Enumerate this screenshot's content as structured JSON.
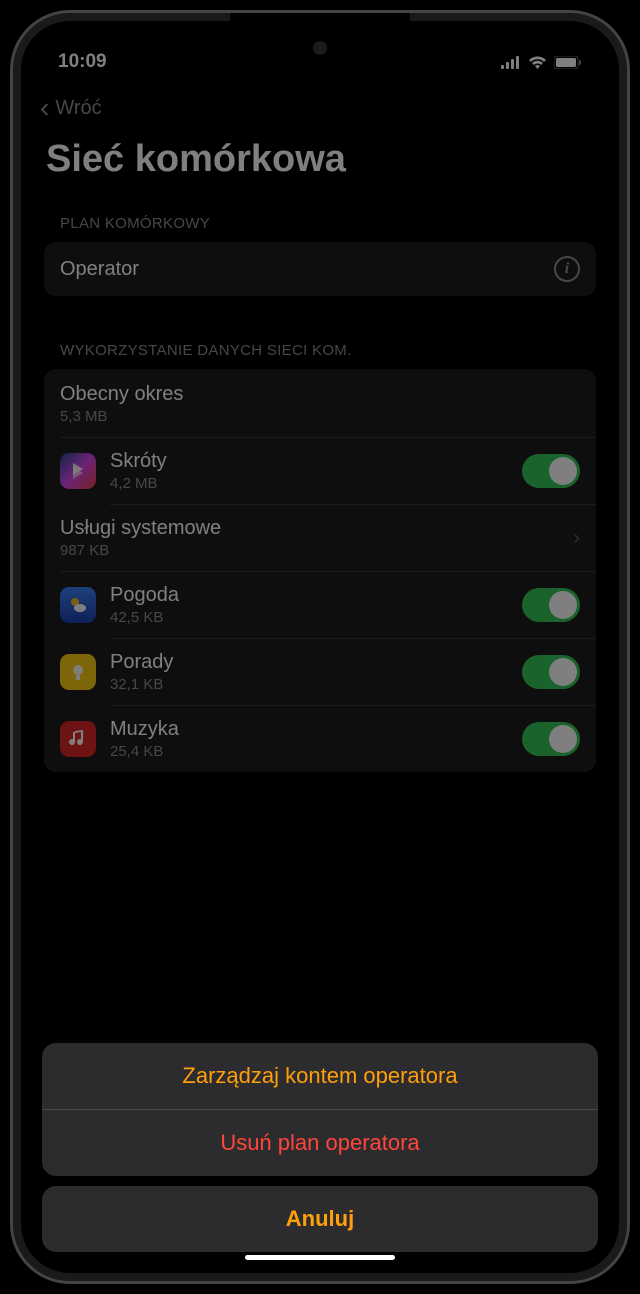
{
  "status": {
    "time": "10:09"
  },
  "nav": {
    "back_label": "Wróć",
    "title": "Sieć komórkowa"
  },
  "plan_section": {
    "header": "PLAN KOMÓRKOWY",
    "operator_label": "Operator"
  },
  "usage_section": {
    "header": "WYKORZYSTANIE DANYCH SIECI KOM.",
    "current_period": {
      "label": "Obecny okres",
      "value": "5,3 MB"
    },
    "system_services": {
      "label": "Usługi systemowe",
      "value": "987 KB"
    },
    "apps": [
      {
        "name": "Skróty",
        "usage": "4,2 MB",
        "icon": "shortcuts"
      },
      {
        "name": "Pogoda",
        "usage": "42,5 KB",
        "icon": "weather"
      },
      {
        "name": "Porady",
        "usage": "32,1 KB",
        "icon": "tips"
      },
      {
        "name": "Muzyka",
        "usage": "25,4 KB",
        "icon": "music"
      }
    ]
  },
  "action_sheet": {
    "manage": "Zarządzaj kontem operatora",
    "remove": "Usuń plan operatora",
    "cancel": "Anuluj"
  }
}
